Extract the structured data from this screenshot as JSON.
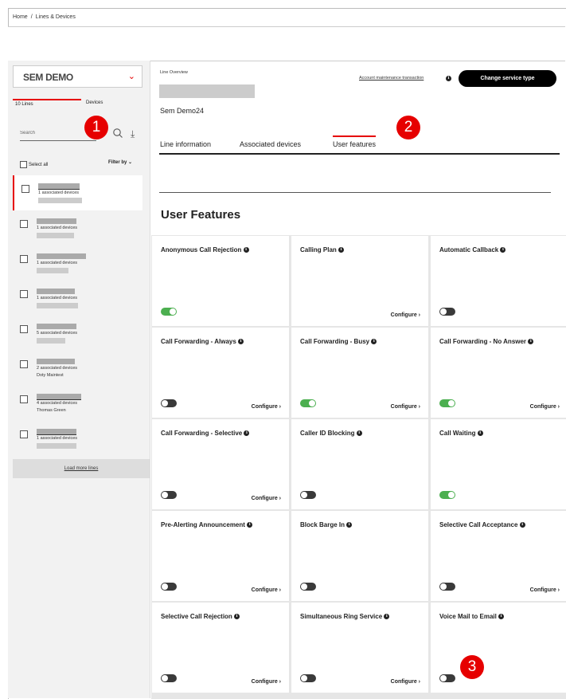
{
  "breadcrumb": {
    "home": "Home",
    "separator": "/",
    "current": "Lines & Devices"
  },
  "sidebar": {
    "account": "SEM DEMO",
    "tabs": {
      "lines": "10 Lines",
      "devices": "Devices"
    },
    "search_placeholder": "Search",
    "select_all": "Select all",
    "filter_by": "Filter by",
    "lines": [
      {
        "devices": "1 associated devices",
        "sub": ""
      },
      {
        "devices": "1 associated devices",
        "sub": ""
      },
      {
        "devices": "1 associated devices",
        "sub": ""
      },
      {
        "devices": "1 associated devices",
        "sub": ""
      },
      {
        "devices": "5 associated devices",
        "sub": ""
      },
      {
        "devices": "2 associated devices",
        "sub": "Doty Maintest"
      },
      {
        "devices": "4 associated devices",
        "sub": "Thomas Green"
      },
      {
        "devices": "1 associated devices",
        "sub": ""
      }
    ],
    "load_more": "Load more lines"
  },
  "main": {
    "line_overview": "Line Overview",
    "line_name": "Sem Demo24",
    "account_link": "Account maintenance transaction",
    "change_button": "Change service type",
    "tabs": [
      "Line information",
      "Associated devices",
      "User features"
    ],
    "section_title": "User Features",
    "info_glyph": "i",
    "configure_label": "Configure",
    "features": [
      {
        "name": "Anonymous Call Rejection",
        "enabled": true,
        "configure": false
      },
      {
        "name": "Calling Plan",
        "enabled": null,
        "configure": true
      },
      {
        "name": "Automatic Callback",
        "enabled": false,
        "configure": false
      },
      {
        "name": "Call Forwarding - Always",
        "enabled": false,
        "configure": true
      },
      {
        "name": "Call Forwarding - Busy",
        "enabled": true,
        "configure": true
      },
      {
        "name": "Call Forwarding - No Answer",
        "enabled": true,
        "configure": true
      },
      {
        "name": "Call Forwarding - Selective",
        "enabled": false,
        "configure": true
      },
      {
        "name": "Caller ID Blocking",
        "enabled": false,
        "configure": false
      },
      {
        "name": "Call Waiting",
        "enabled": true,
        "configure": false
      },
      {
        "name": "Pre-Alerting Announcement",
        "enabled": false,
        "configure": true
      },
      {
        "name": "Block Barge In",
        "enabled": false,
        "configure": false
      },
      {
        "name": "Selective Call Acceptance",
        "enabled": false,
        "configure": true
      },
      {
        "name": "Selective Call Rejection",
        "enabled": false,
        "configure": true
      },
      {
        "name": "Simultaneous Ring Service",
        "enabled": false,
        "configure": true
      },
      {
        "name": "Voice Mail to Email",
        "enabled": false,
        "configure": false
      }
    ]
  },
  "annotations": [
    "1",
    "2",
    "3"
  ],
  "colors": {
    "accent": "#e60000",
    "toggle_on": "#4caf50",
    "toggle_off": "#3a3a3a"
  }
}
